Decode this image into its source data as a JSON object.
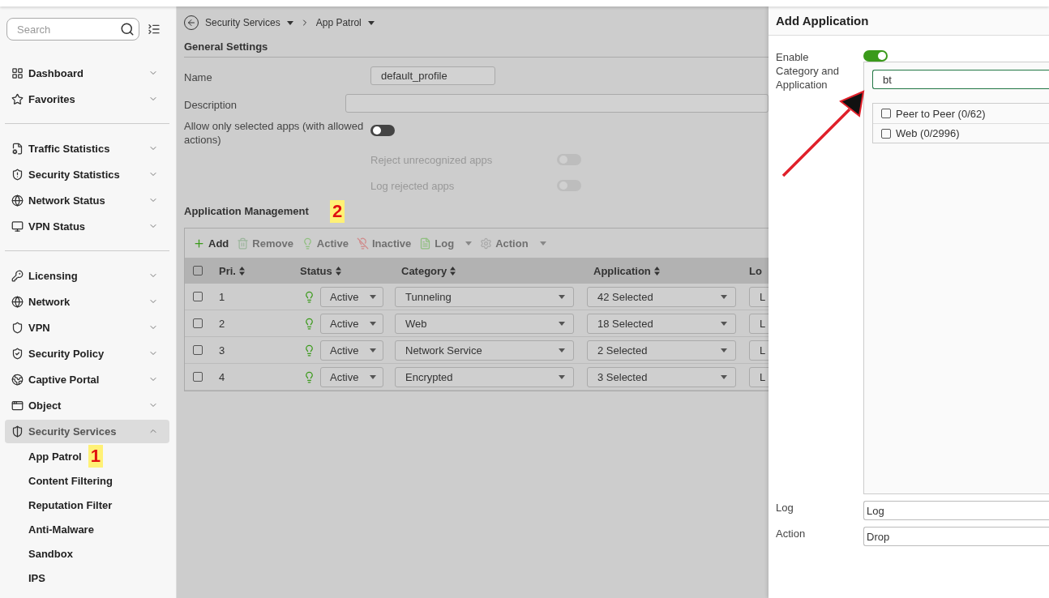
{
  "sidebar": {
    "search": {
      "placeholder": "Search"
    },
    "groups": [
      {
        "items": [
          {
            "label": "Dashboard",
            "expanded": false,
            "selected": false
          },
          {
            "label": "Favorites",
            "expanded": false,
            "selected": false
          }
        ]
      },
      {
        "items": [
          {
            "label": "Traffic Statistics",
            "expanded": false,
            "selected": false
          },
          {
            "label": "Security Statistics",
            "expanded": false,
            "selected": false
          },
          {
            "label": "Network Status",
            "expanded": false,
            "selected": false
          },
          {
            "label": "VPN Status",
            "expanded": false,
            "selected": false
          }
        ]
      },
      {
        "items": [
          {
            "label": "Licensing",
            "expanded": false,
            "selected": false
          },
          {
            "label": "Network",
            "expanded": false,
            "selected": false
          },
          {
            "label": "VPN",
            "expanded": false,
            "selected": false
          },
          {
            "label": "Security Policy",
            "expanded": false,
            "selected": false
          },
          {
            "label": "Captive Portal",
            "expanded": false,
            "selected": false
          },
          {
            "label": "Object",
            "expanded": false,
            "selected": false
          },
          {
            "label": "Security Services",
            "expanded": true,
            "selected": true,
            "children": [
              {
                "label": "App Patrol",
                "marker": "1"
              },
              {
                "label": "Content Filtering"
              },
              {
                "label": "Reputation Filter"
              },
              {
                "label": "Anti-Malware"
              },
              {
                "label": "Sandbox"
              },
              {
                "label": "IPS"
              }
            ]
          }
        ]
      }
    ]
  },
  "breadcrumb": [
    "Security Services",
    "App Patrol"
  ],
  "general_settings": {
    "title": "General Settings",
    "name": {
      "label": "Name",
      "value": "default_profile"
    },
    "description": {
      "label": "Description"
    },
    "allow_only": {
      "label": "Allow only selected apps (with allowed actions)",
      "on": false,
      "disabled": false
    },
    "sub_toggles": [
      {
        "label": "Reject unrecognized apps",
        "on": false,
        "disabled": true
      },
      {
        "label": "Log rejected apps",
        "on": false,
        "disabled": true
      }
    ]
  },
  "application_management": {
    "title": "Application Management",
    "marker": "2",
    "all_checked": false,
    "toolbar": [
      {
        "label": "Add",
        "disabled": false,
        "dropdown": false
      },
      {
        "label": "Remove",
        "disabled": true,
        "dropdown": false
      },
      {
        "label": "Active",
        "disabled": true,
        "dropdown": false
      },
      {
        "label": "Inactive",
        "disabled": true,
        "dropdown": false
      },
      {
        "label": "Log",
        "disabled": true,
        "dropdown": true
      },
      {
        "label": "Action",
        "disabled": true,
        "dropdown": true
      }
    ],
    "columns": [
      "Pri.",
      "Status",
      "Category",
      "Application",
      "Lo"
    ],
    "rows": [
      {
        "checked": false,
        "priority": "1",
        "status": "Active",
        "category": "Tunneling",
        "application": "42 Selected",
        "log": "L"
      },
      {
        "checked": false,
        "priority": "2",
        "status": "Active",
        "category": "Web",
        "application": "18 Selected",
        "log": "L"
      },
      {
        "checked": false,
        "priority": "3",
        "status": "Active",
        "category": "Network Service",
        "application": "2 Selected",
        "log": "L"
      },
      {
        "checked": false,
        "priority": "4",
        "status": "Active",
        "category": "Encrypted",
        "application": "3 Selected",
        "log": "L"
      }
    ]
  },
  "panel": {
    "title": "Add Application",
    "enable": {
      "label": "Enable Category and Application",
      "on": true
    },
    "search": {
      "value": "bt"
    },
    "categories": [
      {
        "label": "Peer to Peer (0/62)",
        "checked": false
      },
      {
        "label": "Web (0/2996)",
        "checked": false
      }
    ],
    "log": {
      "label": "Log",
      "value": "Log"
    },
    "action": {
      "label": "Action",
      "value": "Drop"
    }
  }
}
